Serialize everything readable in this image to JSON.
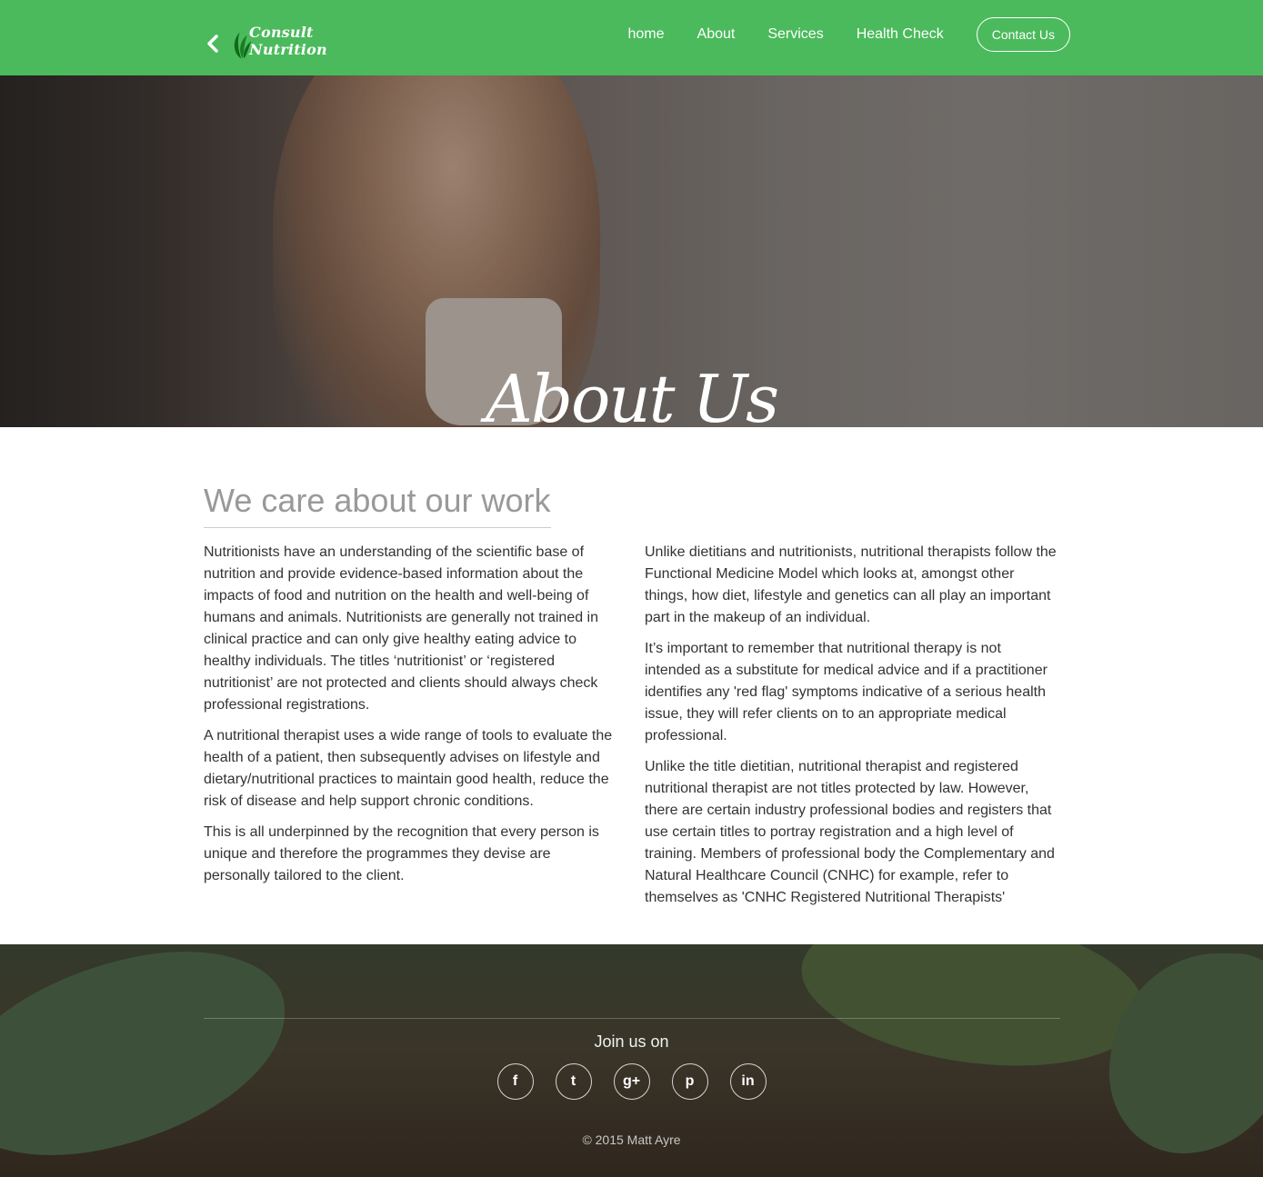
{
  "header": {
    "brand": "Consult Nutrition",
    "nav": [
      "home",
      "About",
      "Services",
      "Health Check"
    ],
    "contact_label": "Contact Us"
  },
  "hero": {
    "title": "About Us"
  },
  "about": {
    "heading": "We care about our work",
    "left_paragraphs": [
      "Nutritionists have an understanding of the scientific base of nutrition and provide evidence-based information about the impacts of food and nutrition on the health and well-being of humans and animals. Nutritionists are generally not trained in clinical practice and can only give healthy eating advice to healthy individuals. The titles ‘nutritionist’ or ‘registered nutritionist’ are not protected and clients should always check professional registrations.",
      "A nutritional therapist uses a wide range of tools to evaluate the health of a patient, then subsequently advises on lifestyle and dietary/nutritional practices to maintain good health, reduce the risk of disease and help support chronic conditions.",
      "This is all underpinned by the recognition that every person is unique and therefore the programmes they devise are personally tailored to the client."
    ],
    "right_paragraphs": [
      "Unlike dietitians and nutritionists, nutritional therapists follow the Functional Medicine Model which looks at, amongst other things, how diet, lifestyle and genetics can all play an important part in the makeup of an individual.",
      "It’s important to remember that nutritional therapy is not intended as a substitute for medical advice and if a practitioner identifies any 'red flag' symptoms indicative of a serious health issue, they will refer clients on to an appropriate medical professional.",
      "Unlike the title dietitian, nutritional therapist and registered nutritional therapist are not titles protected by law. However, there are certain industry professional bodies and registers that use certain titles to portray registration and a high level of training. Members of professional body the Complementary and Natural Healthcare Council (CNHC) for example, refer to themselves as 'CNHC Registered Nutritional Therapists'"
    ]
  },
  "footer": {
    "join_title": "Join us on",
    "social_icons": [
      "facebook-icon",
      "twitter-icon",
      "google-plus-icon",
      "pinterest-icon",
      "linkedin-icon"
    ],
    "social_glyphs": [
      "f",
      "t",
      "g+",
      "p",
      "in"
    ],
    "copyright": "© 2015 Matt Ayre"
  },
  "colors": {
    "header_green": "#4bba5c",
    "heading_gray": "#999999",
    "body_text": "#333333"
  }
}
